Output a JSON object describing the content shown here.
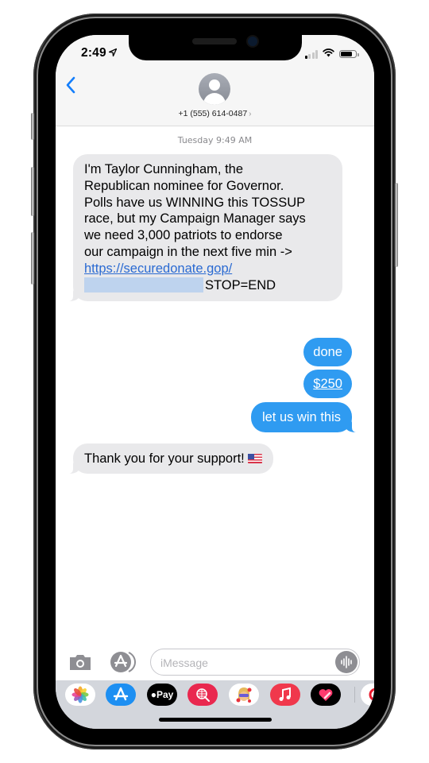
{
  "status_bar": {
    "time": "2:49",
    "location_icon": "location-arrow-icon",
    "signal_icon": "cellular-signal-icon",
    "wifi_icon": "wifi-icon",
    "battery_icon": "battery-icon",
    "battery_level": 0.8
  },
  "header": {
    "back_icon": "chevron-left-icon",
    "avatar_icon": "person-avatar-icon",
    "contact": "+1 (555) 614-0487",
    "contact_chevron": "›"
  },
  "conversation": {
    "timestamp": "Tuesday 9:49 AM",
    "messages": [
      {
        "direction": "received",
        "lines": [
          "I'm Taylor Cunningham, the",
          "Republican nominee for Governor.",
          "Polls have us WINNING this TOSSUP",
          "race, but my Campaign Manager says",
          "we need 3,000 patriots to endorse",
          "our campaign in the next five min ->"
        ],
        "link": "https://securedonate.gop/",
        "redacted": true,
        "suffix": "STOP=END"
      },
      {
        "direction": "sent",
        "text": "done"
      },
      {
        "direction": "sent",
        "text": "$250"
      },
      {
        "direction": "sent",
        "text": "let us win this"
      },
      {
        "direction": "received",
        "text": "Thank you for your support!",
        "emoji": "us-flag-icon"
      }
    ]
  },
  "composer": {
    "camera_icon": "camera-icon",
    "apps_icon": "app-store-icon",
    "placeholder": "iMessage",
    "audio_icon": "audio-waveform-icon"
  },
  "app_tray": {
    "apps": [
      {
        "name": "Photos",
        "icon": "photos-icon",
        "bg": "#ffffff"
      },
      {
        "name": "App Store",
        "icon": "app-store-icon",
        "bg": "#1d8ff2"
      },
      {
        "name": "Apple Pay",
        "icon": "apple-pay-icon",
        "bg": "#000000",
        "label": "Pay"
      },
      {
        "name": "Search Images",
        "icon": "globe-search-icon",
        "bg": "#e9284f"
      },
      {
        "name": "Memoji",
        "icon": "memoji-icon",
        "bg": "#ffffff"
      },
      {
        "name": "Music",
        "icon": "music-note-icon",
        "bg": "#f0384c"
      },
      {
        "name": "Digital Touch",
        "icon": "heart-touch-icon",
        "bg": "#000000"
      },
      {
        "name": "More",
        "icon": "partial-app-icon",
        "bg": "#ffffff"
      }
    ]
  },
  "colors": {
    "sent_bubble": "#2f9bf1",
    "received_bubble": "#e9e9eb",
    "link": "#2a6ad2",
    "accent": "#147efb"
  }
}
